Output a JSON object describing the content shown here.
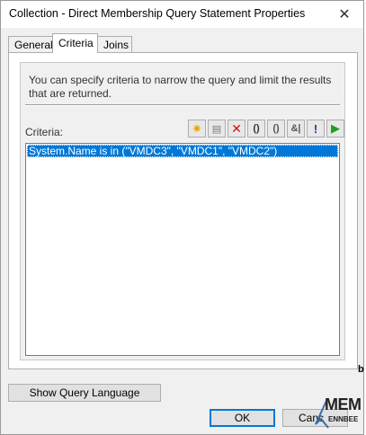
{
  "window": {
    "title": "Collection - Direct Membership Query Statement Properties",
    "close_symbol": "✕"
  },
  "tabs": [
    {
      "label": "General",
      "active": false
    },
    {
      "label": "Criteria",
      "active": true
    },
    {
      "label": "Joins",
      "active": false
    }
  ],
  "criteria_tab": {
    "description": "You can specify criteria to narrow the query and limit the results that are returned.",
    "criteria_label": "Criteria:",
    "toolbar": [
      {
        "name": "new-criterion",
        "icon": "star-icon",
        "glyph": "✷",
        "color": "#e8a800"
      },
      {
        "name": "properties",
        "icon": "properties-icon",
        "glyph": "▤",
        "color": "#7a7a7a"
      },
      {
        "name": "delete",
        "icon": "delete-icon",
        "glyph": "✕",
        "color": "#d01010"
      },
      {
        "name": "add-parentheses",
        "icon": "parentheses-new-icon",
        "glyph": "()",
        "color": "#333333"
      },
      {
        "name": "remove-parentheses",
        "icon": "parentheses-remove-icon",
        "glyph": "()",
        "color": "#555555"
      },
      {
        "name": "and-operator",
        "icon": "and-icon",
        "glyph": "&|",
        "color": "#555555"
      },
      {
        "name": "not-operator",
        "icon": "not-icon",
        "glyph": "!",
        "color": "#1a3c8c"
      },
      {
        "name": "run",
        "icon": "play-icon",
        "glyph": "▶",
        "color": "#1ea01e"
      }
    ],
    "criteria_items": [
      "System.Name is in (\"VMDC3\", \"VMDC1\", \"VMDC2\")"
    ]
  },
  "footer": {
    "show_query_language": "Show Query Language",
    "ok": "OK",
    "cancel": "Canc"
  },
  "side_text": "b",
  "watermark": {
    "main": "MEM",
    "sub": "ENNBEE"
  },
  "colors": {
    "selection": "#0078d7",
    "dialog_bg": "#f0f0f0"
  }
}
